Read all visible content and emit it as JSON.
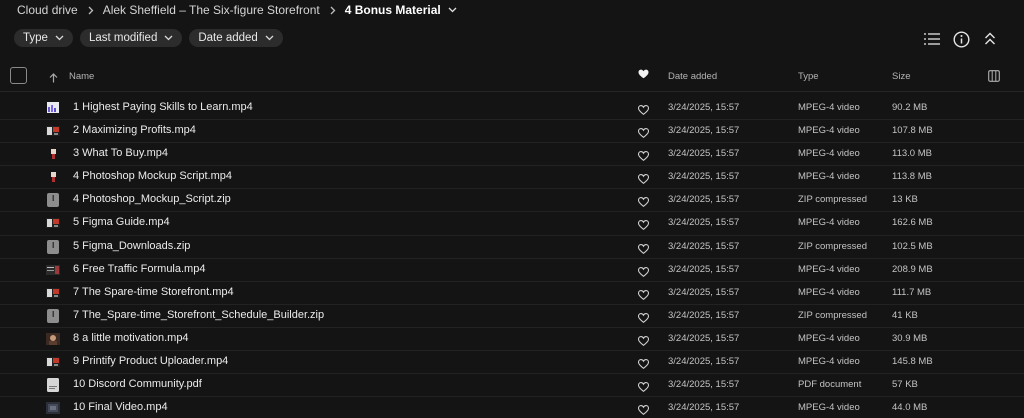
{
  "breadcrumb": {
    "items": [
      "Cloud drive",
      "Alek Sheffield – The Six-figure Storefront",
      "4 Bonus Material"
    ]
  },
  "filters": [
    "Type",
    "Last modified",
    "Date added"
  ],
  "toolbar_icons": [
    "list-view-icon",
    "info-icon",
    "collapse-icon"
  ],
  "columns": {
    "name": "Name",
    "date_added": "Date added",
    "type": "Type",
    "size": "Size"
  },
  "files": [
    {
      "name": "1 Highest Paying Skills to Learn.mp4",
      "date": "3/24/2025, 15:57",
      "type": "MPEG-4 video",
      "size": "90.2 MB",
      "thumb": "video-a"
    },
    {
      "name": "2 Maximizing Profits.mp4",
      "date": "3/24/2025, 15:57",
      "type": "MPEG-4 video",
      "size": "107.8 MB",
      "thumb": "video-b"
    },
    {
      "name": "3 What To Buy.mp4",
      "date": "3/24/2025, 15:57",
      "type": "MPEG-4 video",
      "size": "113.0 MB",
      "thumb": "video-c"
    },
    {
      "name": "4 Photoshop Mockup Script.mp4",
      "date": "3/24/2025, 15:57",
      "type": "MPEG-4 video",
      "size": "113.8 MB",
      "thumb": "video-c"
    },
    {
      "name": "4 Photoshop_Mockup_Script.zip",
      "date": "3/24/2025, 15:57",
      "type": "ZIP compressed",
      "size": "13 KB",
      "thumb": "zip"
    },
    {
      "name": "5 Figma Guide.mp4",
      "date": "3/24/2025, 15:57",
      "type": "MPEG-4 video",
      "size": "162.6 MB",
      "thumb": "video-b"
    },
    {
      "name": "5 Figma_Downloads.zip",
      "date": "3/24/2025, 15:57",
      "type": "ZIP compressed",
      "size": "102.5 MB",
      "thumb": "zip"
    },
    {
      "name": "6 Free Traffic Formula.mp4",
      "date": "3/24/2025, 15:57",
      "type": "MPEG-4 video",
      "size": "208.9 MB",
      "thumb": "video-d"
    },
    {
      "name": "7 The Spare-time Storefront.mp4",
      "date": "3/24/2025, 15:57",
      "type": "MPEG-4 video",
      "size": "111.7 MB",
      "thumb": "video-b"
    },
    {
      "name": "7 The_Spare-time_Storefront_Schedule_Builder.zip",
      "date": "3/24/2025, 15:57",
      "type": "ZIP compressed",
      "size": "41 KB",
      "thumb": "zip"
    },
    {
      "name": "8 a little motivation.mp4",
      "date": "3/24/2025, 15:57",
      "type": "MPEG-4 video",
      "size": "30.9 MB",
      "thumb": "video-e"
    },
    {
      "name": "9 Printify Product Uploader.mp4",
      "date": "3/24/2025, 15:57",
      "type": "MPEG-4 video",
      "size": "145.8 MB",
      "thumb": "video-b"
    },
    {
      "name": "10 Discord Community.pdf",
      "date": "3/24/2025, 15:57",
      "type": "PDF document",
      "size": "57 KB",
      "thumb": "pdf"
    },
    {
      "name": "10 Final Video.mp4",
      "date": "3/24/2025, 15:57",
      "type": "MPEG-4 video",
      "size": "44.0 MB",
      "thumb": "video-f"
    }
  ],
  "colors": {
    "background": "#141414",
    "chip": "#2c2c2c",
    "divider": "#222222",
    "text": "#ebebeb",
    "muted_text": "#c4c4c4"
  }
}
